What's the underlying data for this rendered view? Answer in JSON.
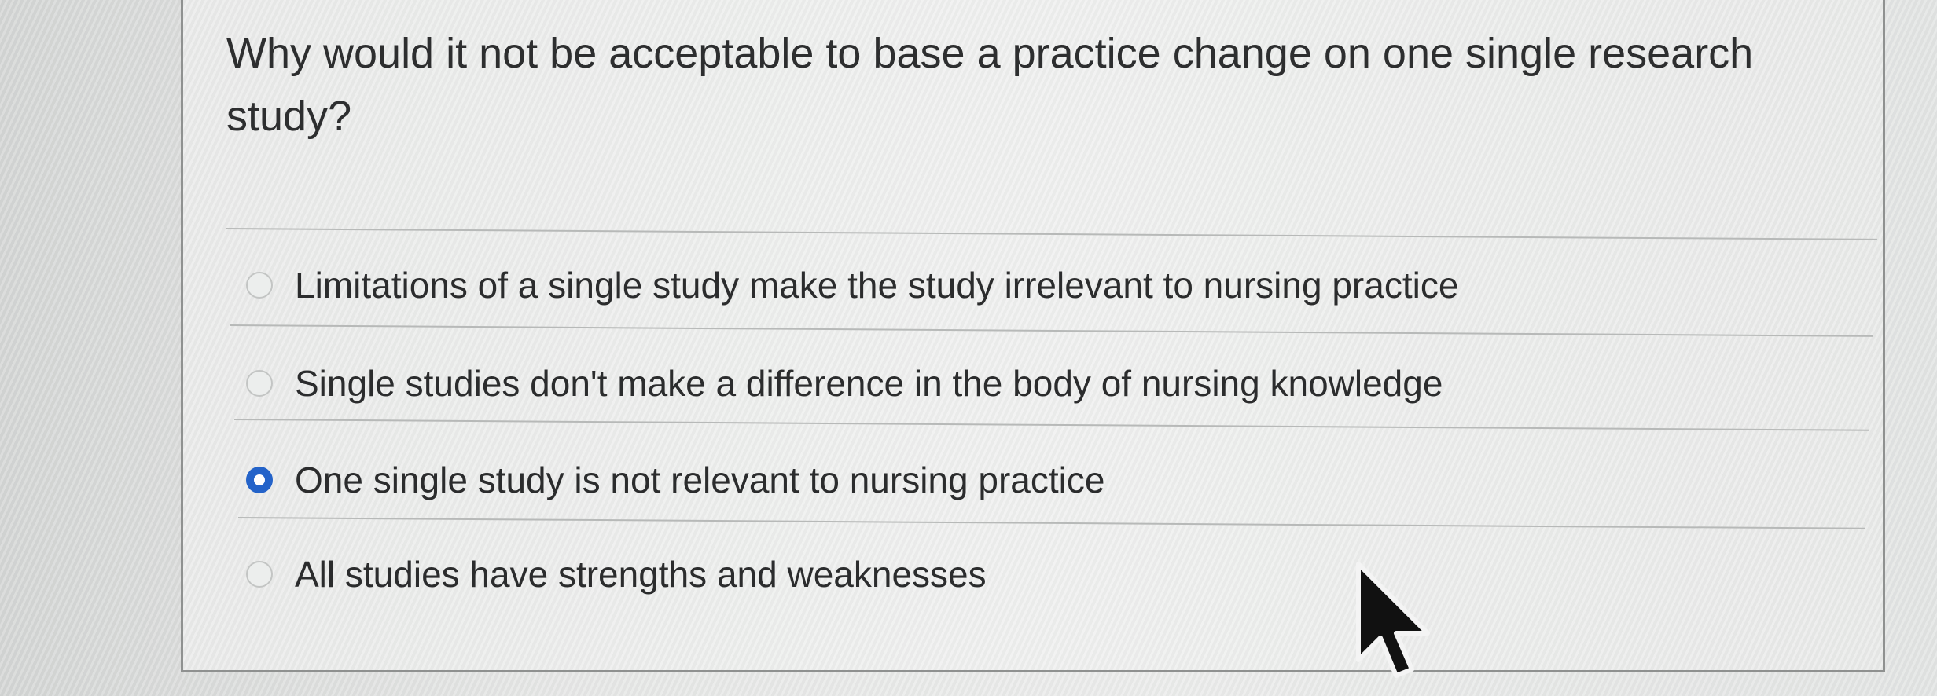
{
  "question": {
    "text": "Why would it not be acceptable to base a practice change on one single research study?"
  },
  "options": [
    {
      "label": "Limitations of a single study make the study irrelevant to nursing practice",
      "selected": false
    },
    {
      "label": "Single studies don't make a difference in the body of nursing knowledge",
      "selected": false
    },
    {
      "label": "One single study is not relevant to nursing practice",
      "selected": true
    },
    {
      "label": "All studies have strengths and weaknesses",
      "selected": false
    }
  ],
  "colors": {
    "selected_radio": "#2463c9",
    "text": "#2d2e2f"
  }
}
